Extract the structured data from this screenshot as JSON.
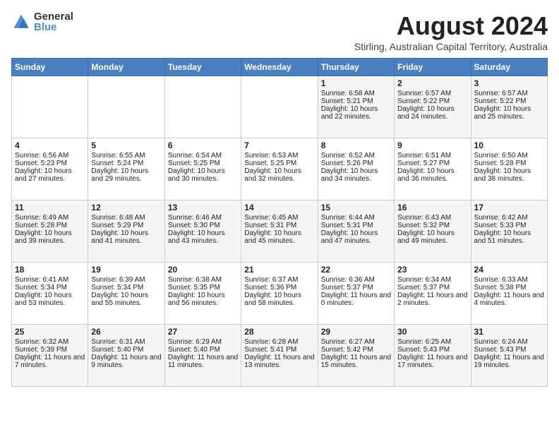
{
  "logo": {
    "general": "General",
    "blue": "Blue"
  },
  "title": {
    "month_year": "August 2024",
    "location": "Stirling, Australian Capital Territory, Australia"
  },
  "calendar": {
    "headers": [
      "Sunday",
      "Monday",
      "Tuesday",
      "Wednesday",
      "Thursday",
      "Friday",
      "Saturday"
    ],
    "weeks": [
      [
        {
          "day": "",
          "info": ""
        },
        {
          "day": "",
          "info": ""
        },
        {
          "day": "",
          "info": ""
        },
        {
          "day": "",
          "info": ""
        },
        {
          "day": "1",
          "info": "Sunrise: 6:58 AM\nSunset: 5:21 PM\nDaylight: 10 hours and 22 minutes."
        },
        {
          "day": "2",
          "info": "Sunrise: 6:57 AM\nSunset: 5:22 PM\nDaylight: 10 hours and 24 minutes."
        },
        {
          "day": "3",
          "info": "Sunrise: 6:57 AM\nSunset: 5:22 PM\nDaylight: 10 hours and 25 minutes."
        }
      ],
      [
        {
          "day": "4",
          "info": "Sunrise: 6:56 AM\nSunset: 5:23 PM\nDaylight: 10 hours and 27 minutes."
        },
        {
          "day": "5",
          "info": "Sunrise: 6:55 AM\nSunset: 5:24 PM\nDaylight: 10 hours and 29 minutes."
        },
        {
          "day": "6",
          "info": "Sunrise: 6:54 AM\nSunset: 5:25 PM\nDaylight: 10 hours and 30 minutes."
        },
        {
          "day": "7",
          "info": "Sunrise: 6:53 AM\nSunset: 5:25 PM\nDaylight: 10 hours and 32 minutes."
        },
        {
          "day": "8",
          "info": "Sunrise: 6:52 AM\nSunset: 5:26 PM\nDaylight: 10 hours and 34 minutes."
        },
        {
          "day": "9",
          "info": "Sunrise: 6:51 AM\nSunset: 5:27 PM\nDaylight: 10 hours and 36 minutes."
        },
        {
          "day": "10",
          "info": "Sunrise: 6:50 AM\nSunset: 5:28 PM\nDaylight: 10 hours and 38 minutes."
        }
      ],
      [
        {
          "day": "11",
          "info": "Sunrise: 6:49 AM\nSunset: 5:28 PM\nDaylight: 10 hours and 39 minutes."
        },
        {
          "day": "12",
          "info": "Sunrise: 6:48 AM\nSunset: 5:29 PM\nDaylight: 10 hours and 41 minutes."
        },
        {
          "day": "13",
          "info": "Sunrise: 6:46 AM\nSunset: 5:30 PM\nDaylight: 10 hours and 43 minutes."
        },
        {
          "day": "14",
          "info": "Sunrise: 6:45 AM\nSunset: 5:31 PM\nDaylight: 10 hours and 45 minutes."
        },
        {
          "day": "15",
          "info": "Sunrise: 6:44 AM\nSunset: 5:31 PM\nDaylight: 10 hours and 47 minutes."
        },
        {
          "day": "16",
          "info": "Sunrise: 6:43 AM\nSunset: 5:32 PM\nDaylight: 10 hours and 49 minutes."
        },
        {
          "day": "17",
          "info": "Sunrise: 6:42 AM\nSunset: 5:33 PM\nDaylight: 10 hours and 51 minutes."
        }
      ],
      [
        {
          "day": "18",
          "info": "Sunrise: 6:41 AM\nSunset: 5:34 PM\nDaylight: 10 hours and 53 minutes."
        },
        {
          "day": "19",
          "info": "Sunrise: 6:39 AM\nSunset: 5:34 PM\nDaylight: 10 hours and 55 minutes."
        },
        {
          "day": "20",
          "info": "Sunrise: 6:38 AM\nSunset: 5:35 PM\nDaylight: 10 hours and 56 minutes."
        },
        {
          "day": "21",
          "info": "Sunrise: 6:37 AM\nSunset: 5:36 PM\nDaylight: 10 hours and 58 minutes."
        },
        {
          "day": "22",
          "info": "Sunrise: 6:36 AM\nSunset: 5:37 PM\nDaylight: 11 hours and 0 minutes."
        },
        {
          "day": "23",
          "info": "Sunrise: 6:34 AM\nSunset: 5:37 PM\nDaylight: 11 hours and 2 minutes."
        },
        {
          "day": "24",
          "info": "Sunrise: 6:33 AM\nSunset: 5:38 PM\nDaylight: 11 hours and 4 minutes."
        }
      ],
      [
        {
          "day": "25",
          "info": "Sunrise: 6:32 AM\nSunset: 5:39 PM\nDaylight: 11 hours and 7 minutes."
        },
        {
          "day": "26",
          "info": "Sunrise: 6:31 AM\nSunset: 5:40 PM\nDaylight: 11 hours and 9 minutes."
        },
        {
          "day": "27",
          "info": "Sunrise: 6:29 AM\nSunset: 5:40 PM\nDaylight: 11 hours and 11 minutes."
        },
        {
          "day": "28",
          "info": "Sunrise: 6:28 AM\nSunset: 5:41 PM\nDaylight: 11 hours and 13 minutes."
        },
        {
          "day": "29",
          "info": "Sunrise: 6:27 AM\nSunset: 5:42 PM\nDaylight: 11 hours and 15 minutes."
        },
        {
          "day": "30",
          "info": "Sunrise: 6:25 AM\nSunset: 5:43 PM\nDaylight: 11 hours and 17 minutes."
        },
        {
          "day": "31",
          "info": "Sunrise: 6:24 AM\nSunset: 5:43 PM\nDaylight: 11 hours and 19 minutes."
        }
      ]
    ]
  }
}
